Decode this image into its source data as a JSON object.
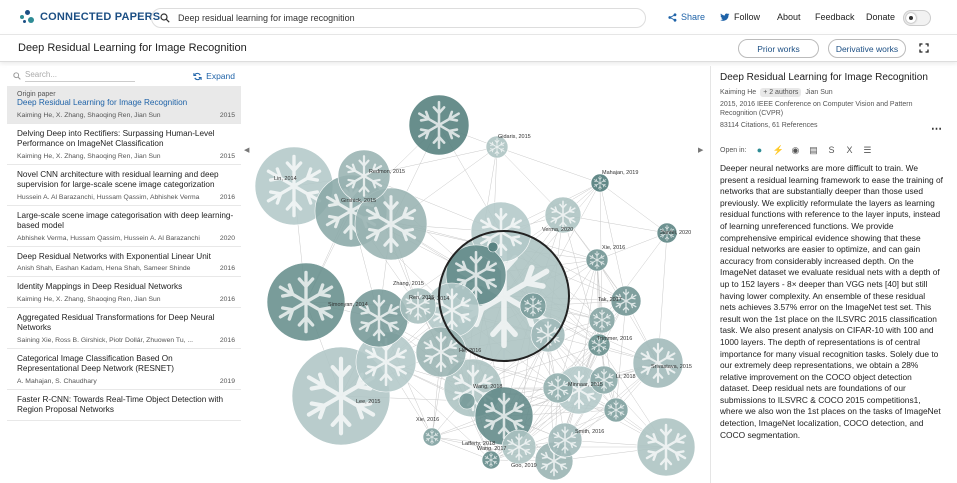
{
  "header": {
    "brand": "CONNECTED PAPERS",
    "search_value": "Deep residual learning for image recognition",
    "nav": {
      "share": "Share",
      "follow": "Follow",
      "about": "About",
      "feedback": "Feedback",
      "donate": "Donate"
    }
  },
  "subbar": {
    "title": "Deep Residual Learning for Image Recognition",
    "prior_works": "Prior works",
    "derivative_works": "Derivative works"
  },
  "sidebar": {
    "search_placeholder": "Search...",
    "expand": "Expand",
    "origin_label": "Origin paper",
    "items": [
      {
        "title": "Deep Residual Learning for Image Recognition",
        "authors": "Kaiming He, X. Zhang, Shaoqing Ren, Jian Sun",
        "year": "2015"
      },
      {
        "title": "Delving Deep into Rectifiers: Surpassing Human-Level Performance on ImageNet Classification",
        "authors": "Kaiming He, X. Zhang, Shaoqing Ren, Jian Sun",
        "year": "2015"
      },
      {
        "title": "Novel CNN architecture with residual learning and deep supervision for large-scale scene image categorization",
        "authors": "Hussein A. Al Barazanchi, Hussam Qassim, Abhishek Verma",
        "year": "2016"
      },
      {
        "title": "Large-scale scene image categorisation with deep learning-based model",
        "authors": "Abhishek Verma, Hussam Qassim, Hussein A. Al Barazanchi",
        "year": "2020"
      },
      {
        "title": "Deep Residual Networks with Exponential Linear Unit",
        "authors": "Anish Shah, Eashan Kadam, Hena Shah, Sameer Shinde",
        "year": "2016"
      },
      {
        "title": "Identity Mappings in Deep Residual Networks",
        "authors": "Kaiming He, X. Zhang, Shaoqing Ren, Jian Sun",
        "year": "2016"
      },
      {
        "title": "Aggregated Residual Transformations for Deep Neural Networks",
        "authors": "Saining Xie, Ross B. Girshick, Piotr Dollár, Zhuowen Tu, ...",
        "year": "2016"
      },
      {
        "title": "Categorical Image Classification Based On Representational Deep Network (RESNET)",
        "authors": "A. Mahajan, S. Chaudhary",
        "year": "2019"
      },
      {
        "title": "Faster R-CNN: Towards Real-Time Object Detection with Region Proposal Networks",
        "authors": "",
        "year": ""
      }
    ]
  },
  "graph": {
    "labels": [
      "Gidaris, 2015",
      "Mahajan, 2019",
      "Lin, 2014",
      "Redmon, 2015",
      "Girshick, 2015",
      "Verma, 2020",
      "Jianfei, 2020",
      "Xie, 2016",
      "Zhang, 2015",
      "Ren, 2015",
      "Simonyan, 2014",
      "He, 2016",
      "Tak, 2017",
      "Trimmer, 2016",
      "Srivastava, 2015",
      "He, 2014",
      "Wang, 2018",
      "Minnaar, 2015",
      "Li, 2018",
      "Lee, 2015",
      "Xie, 2016",
      "Lafferty, 2018",
      "Smith, 2016",
      "Wang, 2017",
      "Goo, 2019"
    ]
  },
  "details": {
    "title": "Deep Residual Learning for Image Recognition",
    "author1": "Kaiming He",
    "more_authors": "+ 2 authors",
    "author_last": "Jian Sun",
    "venue": "2015, 2016 IEEE Conference on Computer Vision and Pattern Recognition (CVPR)",
    "citations": "83114 Citations, 61 References",
    "open_in": "Open in:",
    "abstract": "Deeper neural networks are more difficult to train. We present a residual learning framework to ease the training of networks that are substantially deeper than those used previously. We explicitly reformulate the layers as learning residual functions with reference to the layer inputs, instead of learning unreferenced functions. We provide comprehensive empirical evidence showing that these residual networks are easier to optimize, and can gain accuracy from considerably increased depth. On the ImageNet dataset we evaluate residual nets with a depth of up to 152 layers - 8× deeper than VGG nets [40] but still having lower complexity. An ensemble of these residual nets achieves 3.57% error on the ImageNet test set. This result won the 1st place on the ILSVRC 2015 classification task. We also present analysis on CIFAR-10 with 100 and 1000 layers. The depth of representations is of central importance for many visual recognition tasks. Solely due to our extremely deep representations, we obtain a 28% relative improvement on the COCO object detection dataset. Deep residual nets are foundations of our submissions to ILSVRC & COCO 2015 competitions1, where we also won the 1st places on the tasks of ImageNet detection, ImageNet localization, COCO detection, and COCO segmentation."
  }
}
